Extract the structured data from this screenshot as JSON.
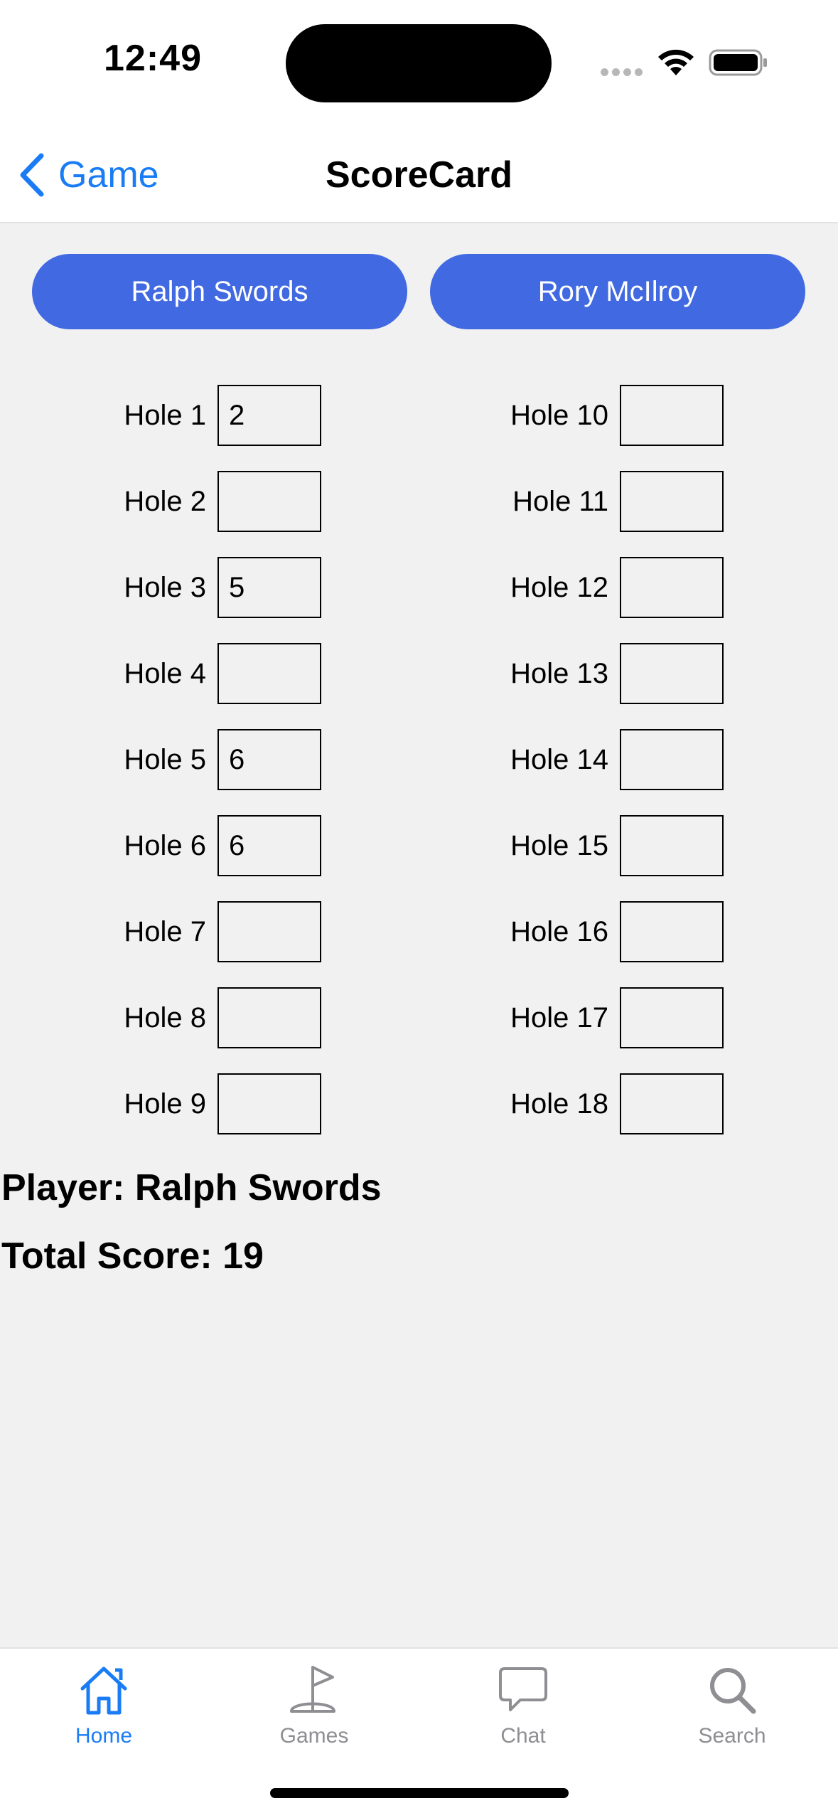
{
  "status_bar": {
    "time": "12:49"
  },
  "nav": {
    "back_label": "Game",
    "title": "ScoreCard"
  },
  "players": {
    "player_1": "Ralph Swords",
    "player_2": "Rory McIlroy"
  },
  "holes_front": [
    {
      "label": "Hole 1",
      "score": "2"
    },
    {
      "label": "Hole 2",
      "score": ""
    },
    {
      "label": "Hole 3",
      "score": "5"
    },
    {
      "label": "Hole 4",
      "score": ""
    },
    {
      "label": "Hole 5",
      "score": "6"
    },
    {
      "label": "Hole 6",
      "score": "6"
    },
    {
      "label": "Hole 7",
      "score": ""
    },
    {
      "label": "Hole 8",
      "score": ""
    },
    {
      "label": "Hole 9",
      "score": ""
    }
  ],
  "holes_back": [
    {
      "label": "Hole 10",
      "score": ""
    },
    {
      "label": "Hole 11",
      "score": ""
    },
    {
      "label": "Hole 12",
      "score": ""
    },
    {
      "label": "Hole 13",
      "score": ""
    },
    {
      "label": "Hole 14",
      "score": ""
    },
    {
      "label": "Hole 15",
      "score": ""
    },
    {
      "label": "Hole 16",
      "score": ""
    },
    {
      "label": "Hole 17",
      "score": ""
    },
    {
      "label": "Hole 18",
      "score": ""
    }
  ],
  "summary": {
    "player_line": "Player: Ralph Swords",
    "total_line": "Total Score: 19"
  },
  "tabs": [
    {
      "label": "Home",
      "icon": "home-icon",
      "active": true
    },
    {
      "label": "Games",
      "icon": "flag-icon",
      "active": false
    },
    {
      "label": "Chat",
      "icon": "chat-bubble-icon",
      "active": false
    },
    {
      "label": "Search",
      "icon": "search-icon",
      "active": false
    }
  ],
  "colors": {
    "accent": "#1a7cf5",
    "player_button": "#4169e1",
    "background": "#f1f1f1",
    "inactive_tab": "#8e8e93"
  }
}
